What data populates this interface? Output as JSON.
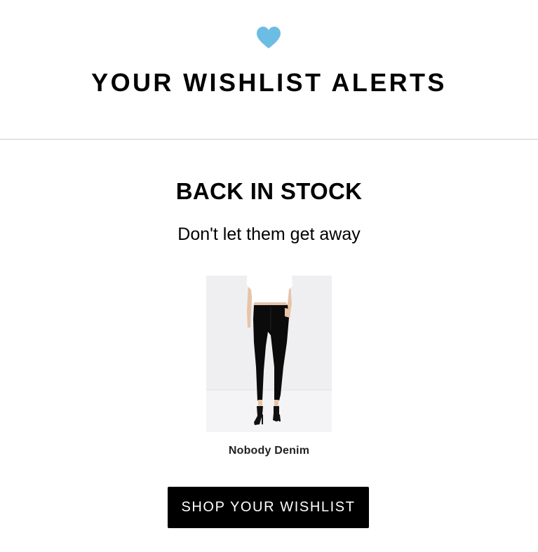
{
  "header": {
    "icon": "heart-icon",
    "title": "YOUR WISHLIST ALERTS",
    "accent_color": "#6cbde3"
  },
  "alert": {
    "heading": "BACK IN STOCK",
    "subheading": "Don't let them get away"
  },
  "product": {
    "name": "Nobody Denim"
  },
  "cta": {
    "label": "SHOP YOUR WISHLIST",
    "background": "#000000"
  }
}
